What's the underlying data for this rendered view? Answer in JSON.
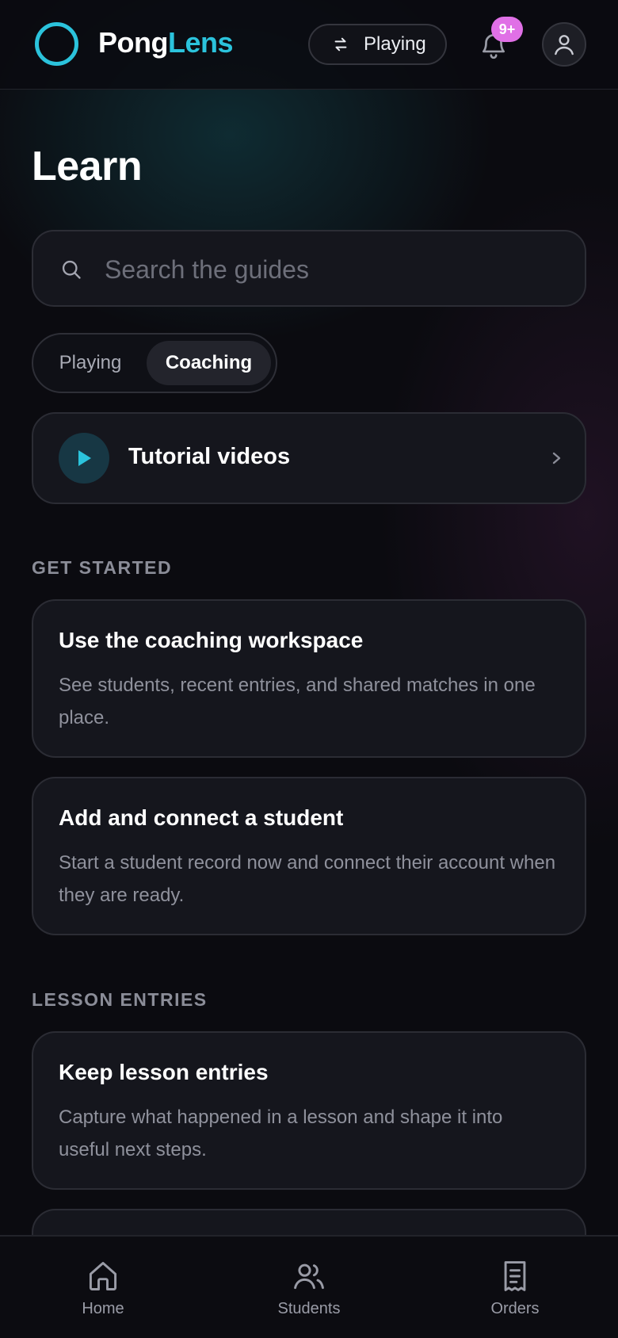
{
  "header": {
    "brand_part1": "Pong",
    "brand_part2": "Lens",
    "mode_label": "Playing",
    "notification_badge": "9+"
  },
  "page": {
    "title": "Learn"
  },
  "search": {
    "placeholder": "Search the guides",
    "value": ""
  },
  "segmented": {
    "options": [
      "Playing",
      "Coaching"
    ],
    "selected": "Coaching"
  },
  "tutorial": {
    "label": "Tutorial videos"
  },
  "sections": [
    {
      "label": "GET STARTED",
      "guides": [
        {
          "title": "Use the coaching workspace",
          "description": "See students, recent entries, and shared matches in one place."
        },
        {
          "title": "Add and connect a student",
          "description": "Start a student record now and connect their account when they are ready."
        }
      ]
    },
    {
      "label": "LESSON ENTRIES",
      "guides": [
        {
          "title": "Keep lesson entries",
          "description": "Capture what happened in a lesson and shape it into useful next steps."
        }
      ]
    }
  ],
  "bottom_nav": {
    "items": [
      {
        "label": "Home",
        "icon": "home-icon"
      },
      {
        "label": "Students",
        "icon": "users-icon"
      },
      {
        "label": "Orders",
        "icon": "receipt-icon"
      }
    ]
  },
  "colors": {
    "accent": "#2bc3dc",
    "badge": "#e070e6",
    "background": "#0b0b10",
    "card": "#15161d"
  }
}
